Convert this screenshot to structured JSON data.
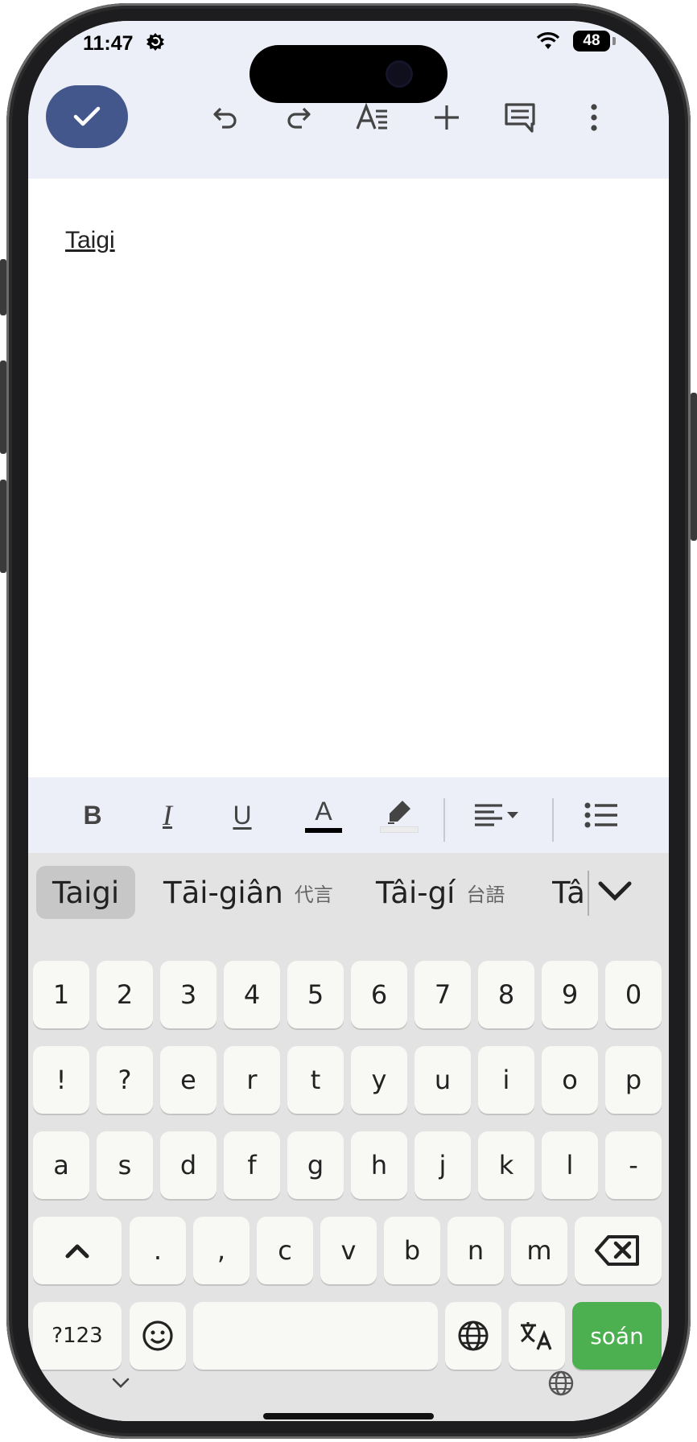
{
  "status": {
    "time": "11:47",
    "battery": "48"
  },
  "toolbar": {
    "done_icon": "check-icon",
    "icons": [
      "undo-icon",
      "redo-icon",
      "text-format-icon",
      "insert-icon",
      "comment-icon",
      "more-vert-icon"
    ]
  },
  "document": {
    "text": "Taigi"
  },
  "format_bar": {
    "bold": "B",
    "italic": "I",
    "underline": "U",
    "text_color": "A",
    "icons": [
      "highlight-icon",
      "align-left-icon",
      "bullet-list-icon"
    ]
  },
  "suggestions": [
    {
      "roman": "Taigi",
      "hanji": "",
      "selected": true
    },
    {
      "roman": "Tāi-giân",
      "hanji": "代言",
      "selected": false
    },
    {
      "roman": "Tâi-gí",
      "hanji": "台語",
      "selected": false
    },
    {
      "roman": "Tâ",
      "hanji": "",
      "selected": false
    }
  ],
  "keyboard": {
    "row1": [
      "1",
      "2",
      "3",
      "4",
      "5",
      "6",
      "7",
      "8",
      "9",
      "0"
    ],
    "row2": [
      "!",
      "?",
      "e",
      "r",
      "t",
      "y",
      "u",
      "i",
      "o",
      "p"
    ],
    "row3": [
      "a",
      "s",
      "d",
      "f",
      "g",
      "h",
      "j",
      "k",
      "l",
      "-"
    ],
    "row4": [
      ".",
      ",",
      "c",
      "v",
      "b",
      "n",
      "m"
    ],
    "symbols_label": "?123",
    "enter_label": "soán"
  },
  "colors": {
    "accent": "#43578c",
    "enter": "#4caf50",
    "bar_bg": "#eceef8"
  }
}
